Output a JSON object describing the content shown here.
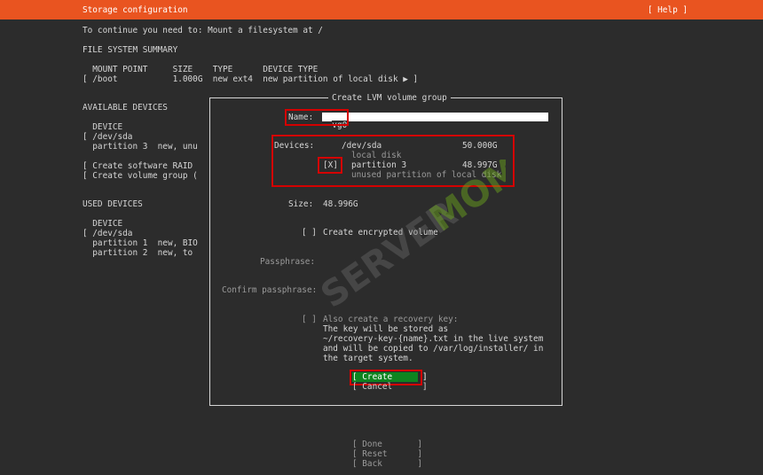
{
  "header": {
    "title": "Storage configuration",
    "help_label": "[ Help ]"
  },
  "instructions": "To continue you need to: Mount a filesystem at /",
  "fs_summary": {
    "heading": "FILE SYSTEM SUMMARY",
    "columns_line": "  MOUNT POINT     SIZE    TYPE      DEVICE TYPE",
    "rows": [
      "[ /boot           1.000G  new ext4  new partition of local disk ▶ ]"
    ]
  },
  "available_devices": {
    "heading": "AVAILABLE DEVICES",
    "device_header": "  DEVICE",
    "lines": [
      "[ /dev/sda",
      "  partition 3  new, unu",
      "",
      "[ Create software RAID",
      "[ Create volume group ("
    ]
  },
  "used_devices": {
    "heading": "USED DEVICES",
    "device_header": "  DEVICE",
    "lines": [
      "[ /dev/sda",
      "  partition 1  new, BIO",
      "  partition 2  new, to"
    ]
  },
  "dialog": {
    "title": "Create LVM volume group",
    "name_label": "Name:",
    "name_value": "vg0",
    "devices_label": "Devices:",
    "device_name": "/dev/sda",
    "device_size": "50.000G",
    "device_desc": "local disk",
    "partition_checkbox": "[X]",
    "partition_name": "partition 3",
    "partition_size": "48.997G",
    "partition_desc": "unused partition of local disk",
    "size_label": "Size:",
    "size_value": "48.996G",
    "encrypt_checkbox": "[ ]",
    "encrypt_label": "Create encrypted volume",
    "passphrase_label": "Passphrase:",
    "confirm_passphrase_label": "Confirm passphrase:",
    "recovery_checkbox": "[ ]",
    "recovery_lines": [
      "Also create a recovery key:",
      "The key will be stored as",
      "~/recovery-key-{name}.txt in the live system",
      "and will be copied to /var/log/installer/ in",
      "the target system."
    ],
    "create_label": "[ Create      ]",
    "cancel_label": "[ Cancel      ]"
  },
  "footer": {
    "done_label": "[ Done       ]",
    "reset_label": "[ Reset      ]",
    "back_label": "[ Back       ]"
  },
  "watermark": {
    "brand_main": "SERVER",
    "brand_accent": "MOM"
  },
  "colors": {
    "header_bg": "#e95420",
    "background": "#2c2c2c",
    "create_button_bg": "#0e8420",
    "highlight_border": "#d40000"
  }
}
